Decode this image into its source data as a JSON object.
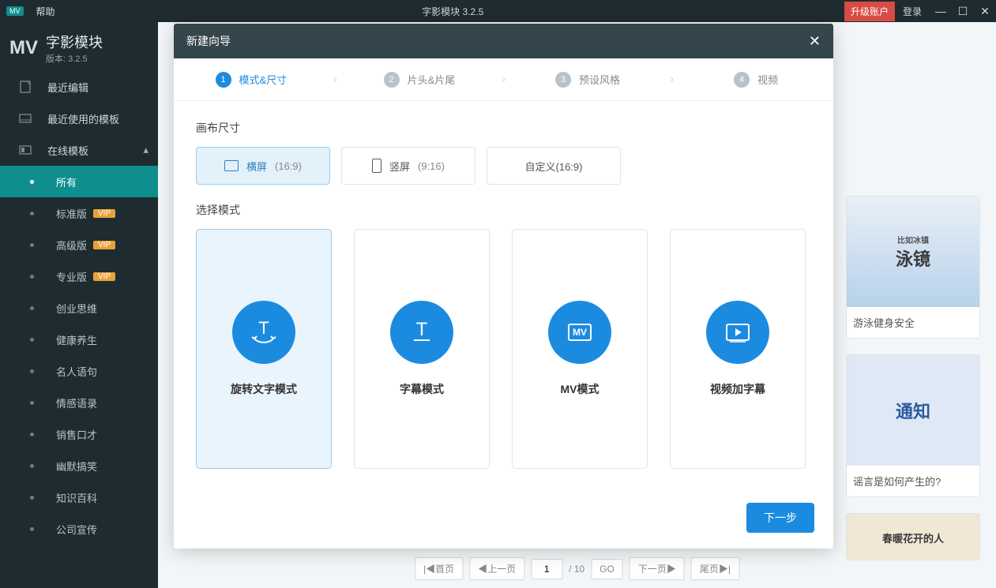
{
  "titlebar": {
    "badge": "MV",
    "help": "帮助",
    "app_title": "字影模块 3.2.5",
    "upgrade": "升级账户",
    "login": "登录"
  },
  "logo": {
    "text": "MV",
    "name": "字影模块",
    "version": "版本: 3.2.5"
  },
  "sidebar": {
    "recent_edit": "最近编辑",
    "recent_templates": "最近使用的模板",
    "online_templates": "在线模板",
    "subs": [
      {
        "label": "所有",
        "vip": false,
        "active": true
      },
      {
        "label": "标准版",
        "vip": true,
        "active": false
      },
      {
        "label": "高级版",
        "vip": true,
        "active": false
      },
      {
        "label": "专业版",
        "vip": true,
        "active": false
      },
      {
        "label": "创业思维",
        "vip": false,
        "active": false
      },
      {
        "label": "健康养生",
        "vip": false,
        "active": false
      },
      {
        "label": "名人语句",
        "vip": false,
        "active": false
      },
      {
        "label": "情感语录",
        "vip": false,
        "active": false
      },
      {
        "label": "销售口才",
        "vip": false,
        "active": false
      },
      {
        "label": "幽默搞笑",
        "vip": false,
        "active": false
      },
      {
        "label": "知识百科",
        "vip": false,
        "active": false
      },
      {
        "label": "公司宣传",
        "vip": false,
        "active": false
      }
    ],
    "vip_label": "VIP"
  },
  "thumbs": [
    {
      "title": "泳镜",
      "caption": "游泳健身安全"
    },
    {
      "title": "通知",
      "caption": "谣言是如何产生的?"
    },
    {
      "title": "春暖花开的人",
      "caption": ""
    }
  ],
  "pager": {
    "first": "首页",
    "prev": "上一页",
    "current": "1",
    "total": "/ 10",
    "go": "GO",
    "next": "下一页",
    "last": "尾页"
  },
  "dialog": {
    "title": "新建向导",
    "steps": [
      {
        "n": "1",
        "label": "模式&尺寸",
        "active": true
      },
      {
        "n": "2",
        "label": "片头&片尾",
        "active": false
      },
      {
        "n": "3",
        "label": "预设风格",
        "active": false
      },
      {
        "n": "4",
        "label": "视频",
        "active": false
      }
    ],
    "canvas_size_title": "画布尺寸",
    "sizes": [
      {
        "label": "横屏",
        "ratio": "(16:9)",
        "active": true,
        "orient": "h"
      },
      {
        "label": "竖屏",
        "ratio": "(9:16)",
        "active": false,
        "orient": "v"
      },
      {
        "label": "自定义(16:9)",
        "ratio": "",
        "active": false,
        "orient": ""
      }
    ],
    "mode_title": "选择模式",
    "modes": [
      {
        "label": "旋转文字模式",
        "icon": "rotate-text",
        "active": true
      },
      {
        "label": "字幕模式",
        "icon": "text",
        "active": false
      },
      {
        "label": "MV模式",
        "icon": "mv",
        "active": false
      },
      {
        "label": "视频加字幕",
        "icon": "video",
        "active": false
      }
    ],
    "next_btn": "下一步"
  }
}
